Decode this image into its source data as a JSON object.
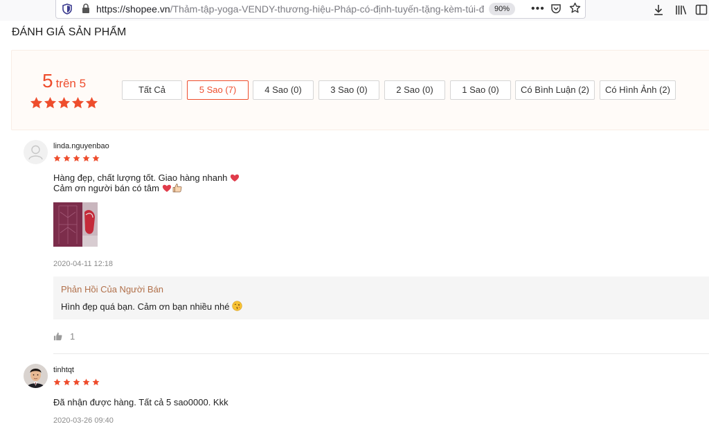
{
  "browser": {
    "url_host": "https://shopee.vn",
    "url_path": "/Thảm-tập-yoga-VENDY-thương-hiệu-Pháp-có-định-tuyến-tặng-kèm-túi-đ",
    "zoom": "90%",
    "page_actions": "•••"
  },
  "ratings": {
    "title": "ĐÁNH GIÁ SẢN PHẨM",
    "score": "5",
    "score_suffix": "trên 5",
    "stars": 5,
    "filters": [
      {
        "label": "Tất Cả",
        "active": false
      },
      {
        "label": "5 Sao (7)",
        "active": true
      },
      {
        "label": "4 Sao (0)",
        "active": false
      },
      {
        "label": "3 Sao (0)",
        "active": false
      },
      {
        "label": "2 Sao (0)",
        "active": false
      },
      {
        "label": "1 Sao (0)",
        "active": false
      },
      {
        "label": "Có Bình Luận (2)",
        "active": false
      },
      {
        "label": "Có Hình Ảnh (2)",
        "active": false
      }
    ]
  },
  "reviews": [
    {
      "username": "linda.nguyenbao",
      "stars": 5,
      "lines": [
        "Hàng đẹp, chất lượng tốt. Giao hàng nhanh",
        "Cảm ơn người bán có tâm"
      ],
      "time": "2020-04-11 12:18",
      "reply_title": "Phản Hồi Của Người Bán",
      "reply_text": "Hình đẹp quá bạn. Cảm ơn bạn nhiều nhé",
      "likes": "1"
    },
    {
      "username": "tinhtqt",
      "stars": 5,
      "lines": [
        "Đã nhận được hàng. Tất cả 5 sao0000. Kkk"
      ],
      "time": "2020-03-26 09:40"
    }
  ],
  "colors": {
    "accent": "#ee4d2d",
    "reply_title": "#b1704a"
  },
  "icons": [
    "shield-icon",
    "lock-icon",
    "pocket-icon",
    "bookmark-star-icon",
    "download-icon",
    "library-icon",
    "sidebar-icon",
    "thumbs-up-icon",
    "heart-emoji-icon",
    "thumbs-up-emoji-icon",
    "kiss-emoji-icon"
  ]
}
